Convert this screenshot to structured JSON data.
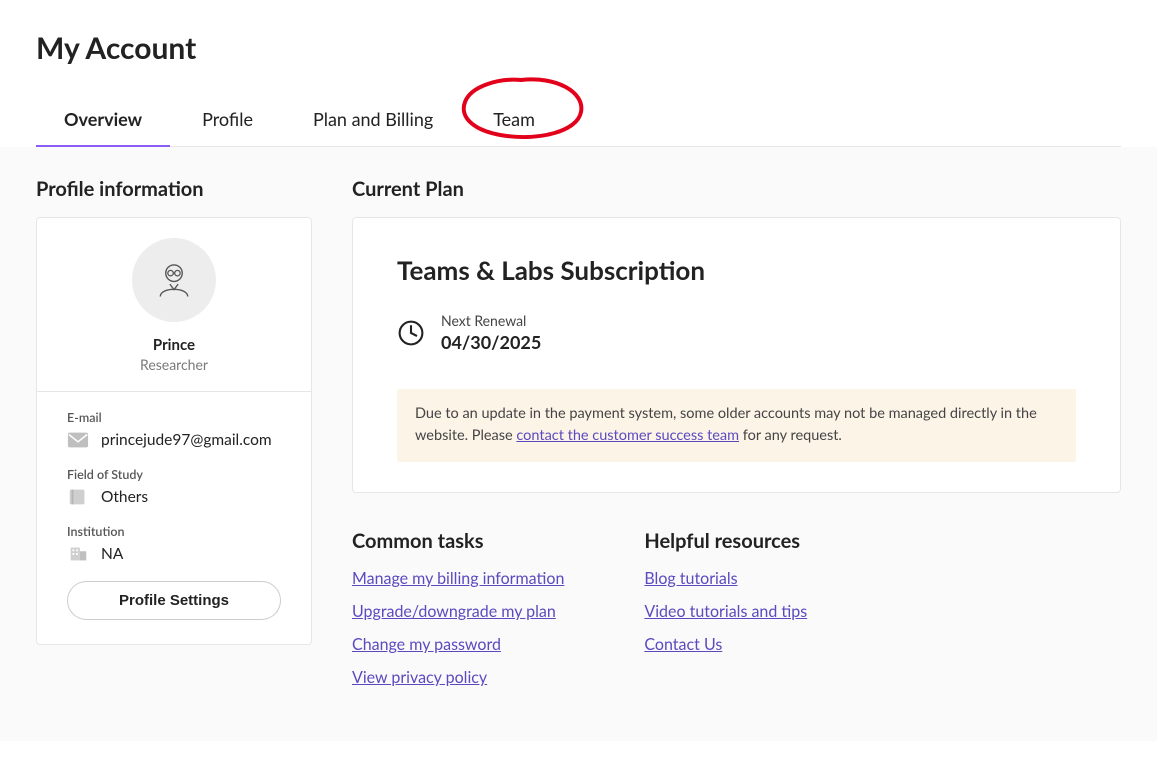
{
  "page_title": "My Account",
  "tabs": {
    "overview": "Overview",
    "profile": "Profile",
    "plan": "Plan and Billing",
    "team": "Team"
  },
  "profile_section": {
    "heading": "Profile information",
    "name": "Prince",
    "role": "Researcher",
    "email_label": "E-mail",
    "email": "princejude97@gmail.com",
    "field_label": "Field of Study",
    "field": "Others",
    "institution_label": "Institution",
    "institution": "NA",
    "settings_button": "Profile Settings"
  },
  "plan_section": {
    "heading": "Current Plan",
    "plan_title": "Teams & Labs Subscription",
    "renewal_label": "Next Renewal",
    "renewal_date": "04/30/2025",
    "notice_pre": "Due to an update in the payment system, some older accounts may not be managed directly in the website. Please ",
    "notice_link": "contact the customer success team",
    "notice_post": " for any request."
  },
  "common_tasks": {
    "heading": "Common tasks",
    "links": {
      "billing": "Manage my billing information",
      "upgrade": "Upgrade/downgrade my plan",
      "password": "Change my password",
      "privacy": "View privacy policy"
    }
  },
  "resources": {
    "heading": "Helpful resources",
    "links": {
      "blog": "Blog tutorials",
      "video": "Video tutorials and tips",
      "contact": "Contact Us"
    }
  }
}
